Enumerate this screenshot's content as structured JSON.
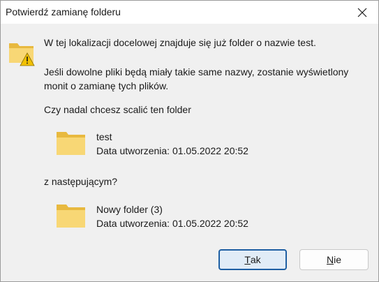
{
  "window": {
    "title": "Potwierdź zamianę folderu"
  },
  "message": {
    "line1": "W tej lokalizacji docelowej znajduje się już folder o nazwie test.",
    "line2a": "Jeśli dowolne pliki będą miały takie same nazwy, zostanie wyświetlony",
    "line2b": "monit o zamianę tych plików.",
    "line3": "Czy nadal chcesz scalić ten folder"
  },
  "target_folder": {
    "name": "test",
    "created": "Data utworzenia: 01.05.2022 20:52"
  },
  "with_label": "z następującym?",
  "source_folder": {
    "name": "Nowy folder (3)",
    "created": "Data utworzenia: 01.05.2022 20:52"
  },
  "buttons": {
    "yes_mnemonic": "T",
    "yes_rest": "ak",
    "no_mnemonic": "N",
    "no_rest": "ie"
  },
  "icons": {
    "warning_folder": "folder-warning-icon",
    "folder": "folder-icon",
    "close": "close-icon"
  },
  "colors": {
    "folder_front": "#f8d775",
    "folder_back": "#e8b93f",
    "warning": "#f2c100",
    "primary_border": "#1e5fa3",
    "primary_fill": "#e1ecf7"
  }
}
